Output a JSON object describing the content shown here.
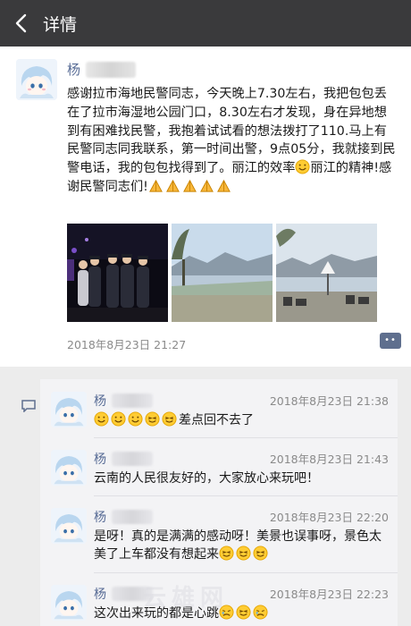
{
  "header": {
    "title": "详情"
  },
  "post": {
    "author": "杨",
    "text": "感谢拉市海地民警同志，今天晚上7.30左右，我把包包丢在了拉市海湿地公园门口，8.30左右才发现，身在异地想到有困难找民警，我抱着试试看的想法拨打了110.马上有民警同志同我联系，第一时间出警，9点05分，我就接到民警电话，我的包包找得到了。丽江的效率",
    "text_mid": "丽江的精神!感谢民警同志们!",
    "time": "2018年8月23日 21:27",
    "photos": [
      "police-officers-night-photo",
      "lake-landscape-photo",
      "lakeside-terrace-photo"
    ]
  },
  "comments": [
    {
      "author": "杨",
      "time": "2018年8月23日 21:38",
      "text": "差点回不去了"
    },
    {
      "author": "杨",
      "time": "2018年8月23日 21:43",
      "text": "云南的人民很友好的，大家放心来玩吧！"
    },
    {
      "author": "杨",
      "time": "2018年8月23日 22:20",
      "text": "是呀！真的是满满的感动呀！美景也误事呀，景色太美了上车都没有想起来"
    },
    {
      "author": "杨",
      "time": "2018年8月23日 22:23",
      "text": "这次出来玩的都是心跳"
    }
  ],
  "watermark": "云雄网",
  "colors": {
    "topbar": "#3a3a3c",
    "name": "#576b95",
    "comment_bg": "#f3f3f5"
  }
}
